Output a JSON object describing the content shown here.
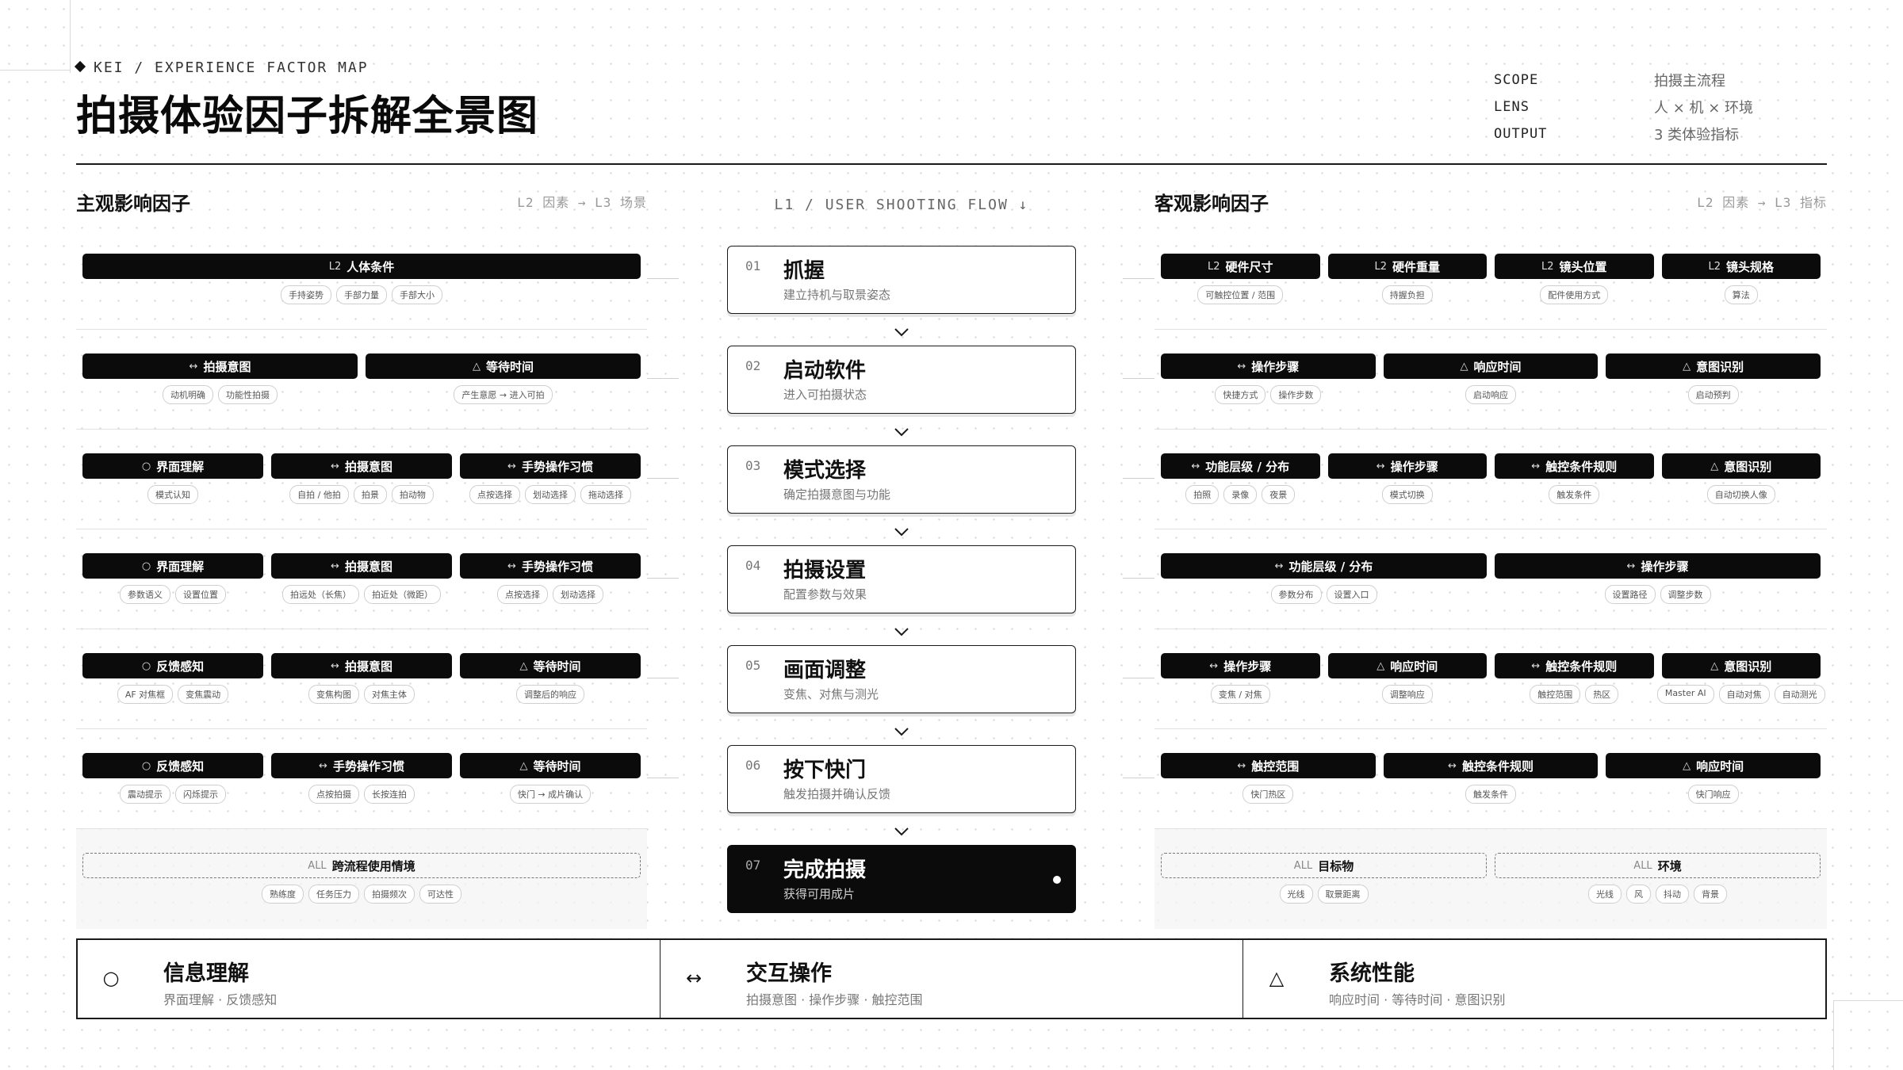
{
  "header": {
    "eyebrow": "KEI / EXPERIENCE FACTOR MAP",
    "title": "拍摄体验因子拆解全景图",
    "meta": [
      {
        "key": "SCOPE",
        "value": "拍摄主流程"
      },
      {
        "key": "LENS",
        "value": "人 × 机 × 环境"
      },
      {
        "key": "OUTPUT",
        "value": "3 类体验指标"
      }
    ]
  },
  "left": {
    "title": "主观影响因子",
    "hint": "L2 因素 → L3 场景",
    "rows": [
      {
        "factors": [
          {
            "prefix": "L2",
            "label": "人体条件",
            "tags": [
              "手持姿势",
              "手部力量",
              "手部大小"
            ]
          }
        ]
      },
      {
        "factors": [
          {
            "prefix": "↔",
            "label": "拍摄意图",
            "tags": [
              "动机明确",
              "功能性拍摄"
            ]
          },
          {
            "prefix": "△",
            "label": "等待时间",
            "tags": [
              "产生意愿 → 进入可拍"
            ]
          }
        ]
      },
      {
        "factors": [
          {
            "prefix": "○",
            "label": "界面理解",
            "tags": [
              "模式认知"
            ]
          },
          {
            "prefix": "↔",
            "label": "拍摄意图",
            "tags": [
              "自拍 / 他拍",
              "拍景",
              "拍动物"
            ]
          },
          {
            "prefix": "↔",
            "label": "手势操作习惯",
            "tags": [
              "点按选择",
              "划动选择",
              "拖动选择"
            ]
          }
        ]
      },
      {
        "factors": [
          {
            "prefix": "○",
            "label": "界面理解",
            "tags": [
              "参数语义",
              "设置位置"
            ]
          },
          {
            "prefix": "↔",
            "label": "拍摄意图",
            "tags": [
              "拍远处（长焦）",
              "拍近处（微距）"
            ]
          },
          {
            "prefix": "↔",
            "label": "手势操作习惯",
            "tags": [
              "点按选择",
              "划动选择"
            ]
          }
        ]
      },
      {
        "factors": [
          {
            "prefix": "○",
            "label": "反馈感知",
            "tags": [
              "AF 对焦框",
              "变焦震动"
            ]
          },
          {
            "prefix": "↔",
            "label": "拍摄意图",
            "tags": [
              "变焦构图",
              "对焦主体"
            ]
          },
          {
            "prefix": "△",
            "label": "等待时间",
            "tags": [
              "调整后的响应"
            ]
          }
        ]
      },
      {
        "factors": [
          {
            "prefix": "○",
            "label": "反馈感知",
            "tags": [
              "震动提示",
              "闪烁提示"
            ]
          },
          {
            "prefix": "↔",
            "label": "手势操作习惯",
            "tags": [
              "点按拍摄",
              "长按连拍"
            ]
          },
          {
            "prefix": "△",
            "label": "等待时间",
            "tags": [
              "快门 → 成片确认"
            ]
          }
        ]
      },
      {
        "last": true,
        "factors": [
          {
            "prefix": "ALL",
            "label": "跨流程使用情境",
            "outline": true,
            "tags": [
              "熟练度",
              "任务压力",
              "拍摄频次",
              "可达性"
            ]
          }
        ]
      }
    ]
  },
  "flow": {
    "header": "L1 / USER SHOOTING FLOW ↓",
    "steps": [
      {
        "num": "01",
        "name": "抓握",
        "desc": "建立持机与取景姿态"
      },
      {
        "num": "02",
        "name": "启动软件",
        "desc": "进入可拍摄状态"
      },
      {
        "num": "03",
        "name": "模式选择",
        "desc": "确定拍摄意图与功能"
      },
      {
        "num": "04",
        "name": "拍摄设置",
        "desc": "配置参数与效果"
      },
      {
        "num": "05",
        "name": "画面调整",
        "desc": "变焦、对焦与测光"
      },
      {
        "num": "06",
        "name": "按下快门",
        "desc": "触发拍摄并确认反馈"
      },
      {
        "num": "07",
        "name": "完成拍摄",
        "desc": "获得可用成片",
        "dark": true
      }
    ]
  },
  "right": {
    "title": "客观影响因子",
    "hint": "L2 因素 → L3 指标",
    "rows": [
      {
        "factors": [
          {
            "prefix": "L2",
            "label": "硬件尺寸",
            "tags": [
              "可触控位置 / 范围"
            ]
          },
          {
            "prefix": "L2",
            "label": "硬件重量",
            "tags": [
              "持握负担"
            ]
          },
          {
            "prefix": "L2",
            "label": "镜头位置",
            "tags": [
              "配件使用方式"
            ]
          },
          {
            "prefix": "L2",
            "label": "镜头规格",
            "tags": [
              "算法"
            ]
          }
        ]
      },
      {
        "factors": [
          {
            "prefix": "↔",
            "label": "操作步骤",
            "tags": [
              "快捷方式",
              "操作步数"
            ]
          },
          {
            "prefix": "△",
            "label": "响应时间",
            "tags": [
              "启动响应"
            ]
          },
          {
            "prefix": "△",
            "label": "意图识别",
            "tags": [
              "启动预判"
            ]
          }
        ]
      },
      {
        "factors": [
          {
            "prefix": "↔",
            "label": "功能层级 / 分布",
            "tags": [
              "拍照",
              "录像",
              "夜景"
            ]
          },
          {
            "prefix": "↔",
            "label": "操作步骤",
            "tags": [
              "模式切换"
            ]
          },
          {
            "prefix": "↔",
            "label": "触控条件规则",
            "tags": [
              "触发条件"
            ]
          },
          {
            "prefix": "△",
            "label": "意图识别",
            "tags": [
              "自动切换人像"
            ]
          }
        ]
      },
      {
        "factors": [
          {
            "prefix": "↔",
            "label": "功能层级 / 分布",
            "tags": [
              "参数分布",
              "设置入口"
            ]
          },
          {
            "prefix": "↔",
            "label": "操作步骤",
            "tags": [
              "设置路径",
              "调整步数"
            ]
          }
        ]
      },
      {
        "factors": [
          {
            "prefix": "↔",
            "label": "操作步骤",
            "tags": [
              "变焦 / 对焦"
            ]
          },
          {
            "prefix": "△",
            "label": "响应时间",
            "tags": [
              "调整响应"
            ]
          },
          {
            "prefix": "↔",
            "label": "触控条件规则",
            "tags": [
              "触控范围",
              "热区"
            ]
          },
          {
            "prefix": "△",
            "label": "意图识别",
            "tags": [
              "Master AI",
              "自动对焦",
              "自动测光"
            ]
          }
        ]
      },
      {
        "factors": [
          {
            "prefix": "↔",
            "label": "触控范围",
            "tags": [
              "快门热区"
            ]
          },
          {
            "prefix": "↔",
            "label": "触控条件规则",
            "tags": [
              "触发条件"
            ]
          },
          {
            "prefix": "△",
            "label": "响应时间",
            "tags": [
              "快门响应"
            ]
          }
        ]
      },
      {
        "last": true,
        "factors": [
          {
            "prefix": "ALL",
            "label": "目标物",
            "outline": true,
            "tags": [
              "光线",
              "取景距离"
            ]
          },
          {
            "prefix": "ALL",
            "label": "环境",
            "outline": true,
            "tags": [
              "光线",
              "风",
              "抖动",
              "背景"
            ]
          }
        ]
      }
    ]
  },
  "legend": [
    {
      "symbol": "○",
      "icon": "circle-icon",
      "title": "信息理解",
      "desc": "界面理解 · 反馈感知"
    },
    {
      "symbol": "↔",
      "icon": "double-arrow-icon",
      "title": "交互操作",
      "desc": "拍摄意图 · 操作步骤 · 触控范围"
    },
    {
      "symbol": "△",
      "icon": "triangle-icon",
      "title": "系统性能",
      "desc": "响应时间 · 等待时间 · 意图识别"
    }
  ]
}
